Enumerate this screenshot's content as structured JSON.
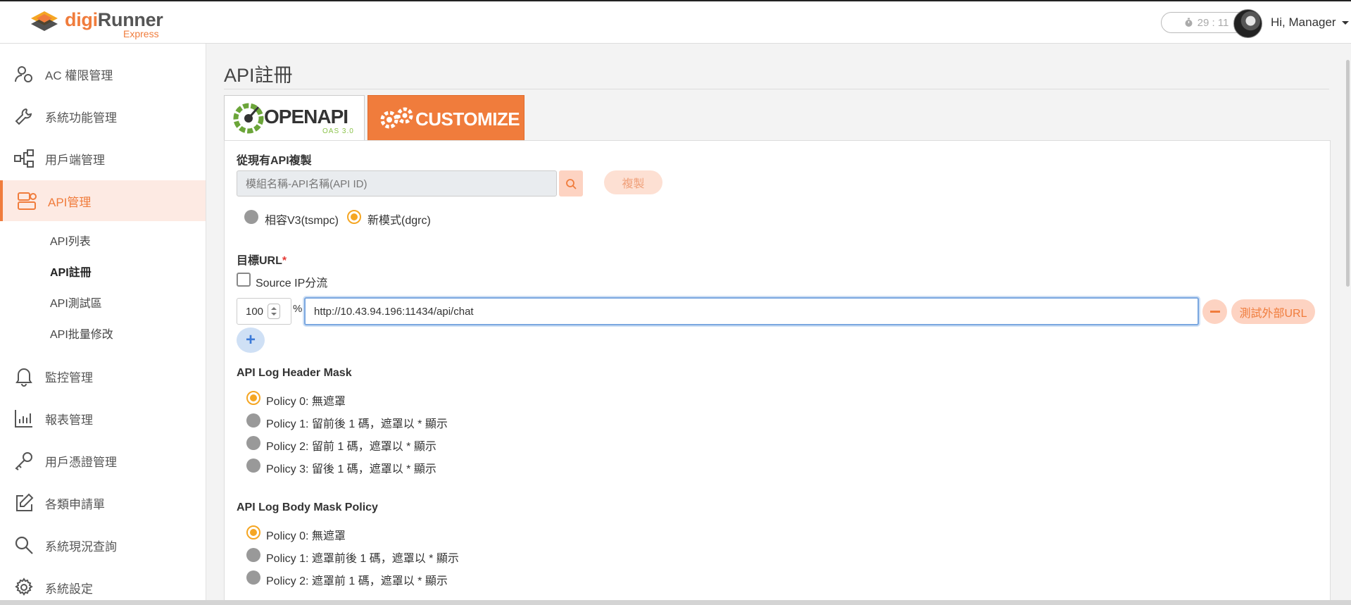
{
  "header": {
    "logo_brand_a": "digi",
    "logo_brand_b": "Runner",
    "logo_sub": "Express",
    "timer": "29 : 11",
    "user_greeting": "Hi, Manager"
  },
  "sidebar": {
    "items": [
      {
        "label": "AC 權限管理",
        "icon": "user-shield-icon"
      },
      {
        "label": "系統功能管理",
        "icon": "wrench-icon"
      },
      {
        "label": "用戶端管理",
        "icon": "network-icon"
      },
      {
        "label": "API管理",
        "icon": "api-box-icon",
        "active": true
      },
      {
        "label": "監控管理",
        "icon": "bell-icon"
      },
      {
        "label": "報表管理",
        "icon": "bar-chart-icon"
      },
      {
        "label": "用戶憑證管理",
        "icon": "key-icon"
      },
      {
        "label": "各類申請單",
        "icon": "edit-icon"
      },
      {
        "label": "系統現況查詢",
        "icon": "search-icon"
      },
      {
        "label": "系統設定",
        "icon": "gear-icon"
      }
    ],
    "sub_items": [
      {
        "label": "API列表"
      },
      {
        "label": "API註冊",
        "current": true
      },
      {
        "label": "API測試區"
      },
      {
        "label": "API批量修改"
      }
    ]
  },
  "page": {
    "title": "API註冊",
    "tabs": {
      "openapi_label": "OPENAPI",
      "openapi_sub": "OAS 3.0",
      "customize_label": "CUSTOMIZE"
    }
  },
  "copy_section": {
    "label": "從現有API複製",
    "placeholder": "模組名稱-API名稱(API ID)",
    "copy_button": "複製",
    "modes": [
      {
        "label": "相容V3(tsmpc)",
        "selected": false
      },
      {
        "label": "新模式(dgrc)",
        "selected": true
      }
    ]
  },
  "target_url": {
    "label": "目標URL",
    "required_mark": "*",
    "source_ip_label": "Source IP分流",
    "source_ip_checked": false,
    "weight_value": "100",
    "percent_sign": "%",
    "url_value": "http://10.43.94.196:11434/api/chat",
    "test_button": "測試外部URL",
    "add_symbol": "+"
  },
  "header_mask": {
    "label": "API Log Header Mask",
    "options": [
      {
        "label": "Policy 0: 無遮罩",
        "selected": true
      },
      {
        "label": "Policy 1: 留前後 1 碼，遮罩以 * 顯示",
        "selected": false
      },
      {
        "label": "Policy 2: 留前 1 碼，遮罩以 * 顯示",
        "selected": false
      },
      {
        "label": "Policy 3: 留後 1 碼，遮罩以 * 顯示",
        "selected": false
      }
    ]
  },
  "body_mask": {
    "label": "API Log Body Mask Policy",
    "options": [
      {
        "label": "Policy 0: 無遮罩",
        "selected": true
      },
      {
        "label": "Policy 1: 遮罩前後 1 碼，遮罩以 * 顯示",
        "selected": false
      },
      {
        "label": "Policy 2: 遮罩前 1 碼，遮罩以 * 顯示",
        "selected": false
      }
    ]
  },
  "colors": {
    "accent": "#f07c3c",
    "accent_light": "#fdd3c2",
    "radio_selected": "#f5a623",
    "focus_blue": "#7aa7e0"
  }
}
